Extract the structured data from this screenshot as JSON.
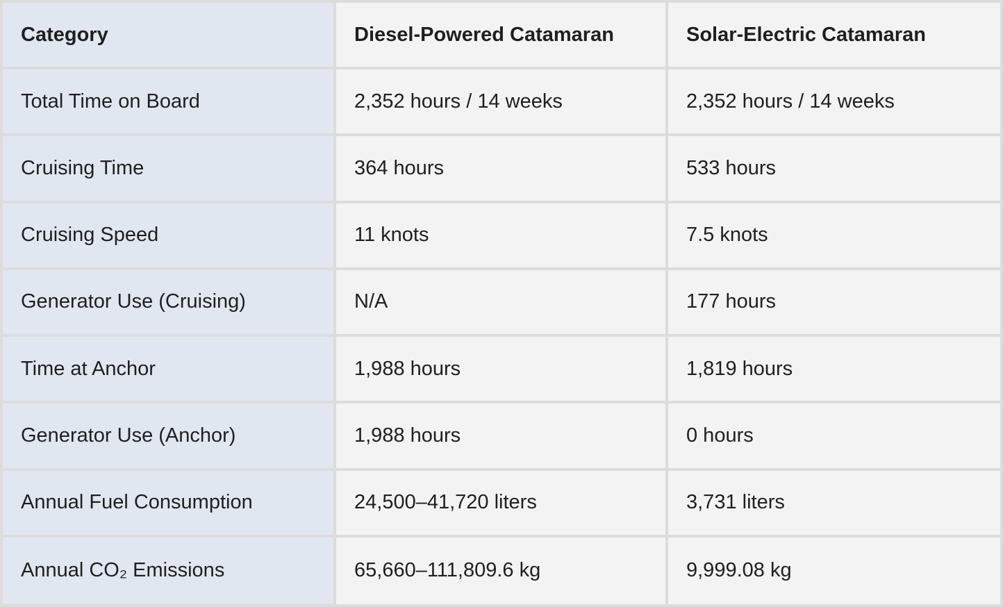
{
  "colors": {
    "header_accent": "#3b5fd9",
    "category_bg": "#e1e7f0",
    "value_bg": "#f3f3f3",
    "grid": "#dcdcdc"
  },
  "table": {
    "headers": [
      "Category",
      "Diesel-Powered Catamaran",
      "Solar-Electric Catamaran"
    ],
    "rows": [
      [
        "Total Time on Board",
        "2,352 hours / 14 weeks",
        "2,352 hours / 14 weeks"
      ],
      [
        "Cruising Time",
        "364 hours",
        "533 hours"
      ],
      [
        "Cruising Speed",
        "11 knots",
        "7.5 knots"
      ],
      [
        "Generator Use (Cruising)",
        "N/A",
        "177 hours"
      ],
      [
        "Time at Anchor",
        "1,988 hours",
        "1,819 hours"
      ],
      [
        "Generator Use (Anchor)",
        "1,988 hours",
        "0 hours"
      ],
      [
        "Annual Fuel Consumption",
        "24,500–41,720 liters",
        "3,731 liters"
      ],
      [
        "Annual CO₂ Emissions",
        "65,660–111,809.6 kg",
        "9,999.08 kg"
      ]
    ]
  }
}
